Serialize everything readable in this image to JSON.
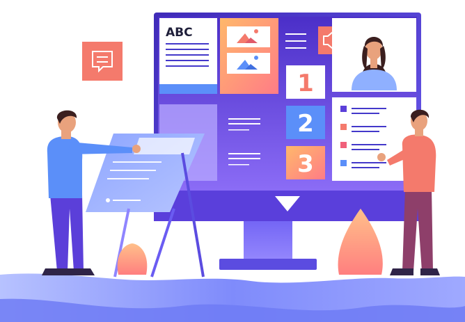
{
  "screen": {
    "doc_heading": "ABC",
    "steps": [
      "1",
      "2",
      "3"
    ]
  },
  "colors": {
    "monitor_frame": "#4338ca",
    "screen_gradient_top": "#5b3fd9",
    "screen_gradient_bottom": "#7b5cf0",
    "coral": "#f47a6c",
    "peach": "#ffb88a",
    "blue_step": "#5b8ff9",
    "lavender": "#b7a8ff",
    "ground": "#6d7df7",
    "skin": "#e9a27d",
    "hair": "#3b1f1f"
  },
  "icons": {
    "chat_bubble": "chat-icon",
    "speaker": "speaker-icon",
    "image_placeholder": "image-icon",
    "play_down": "triangle-down-icon"
  }
}
